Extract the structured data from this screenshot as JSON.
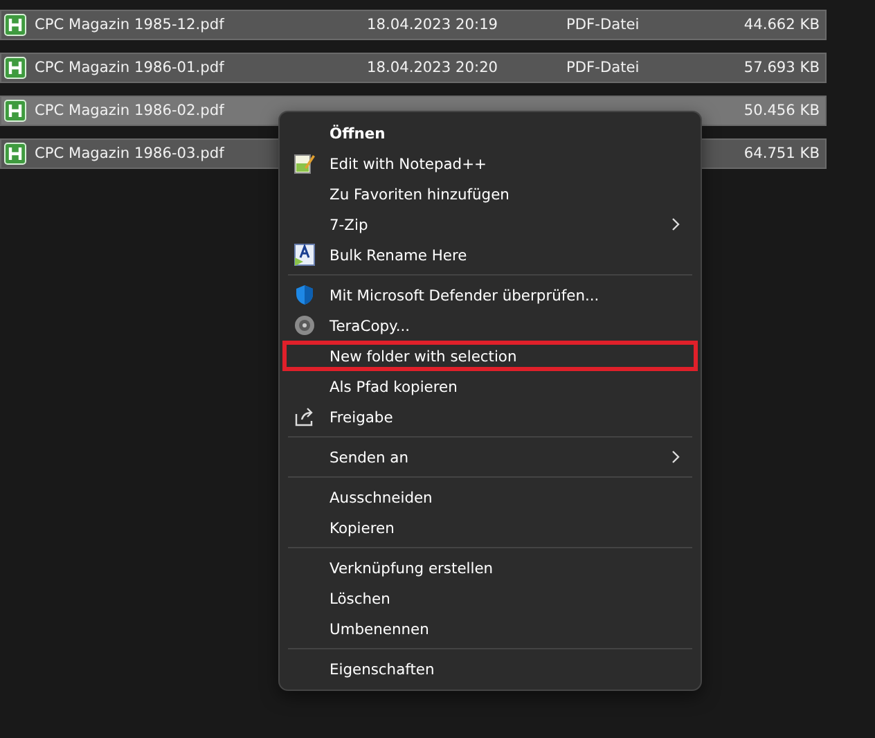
{
  "files": [
    {
      "name": "CPC Magazin 1985-12.pdf",
      "date": "18.04.2023 20:19",
      "type": "PDF-Datei",
      "size": "44.662 KB",
      "selected": true,
      "hovered": false
    },
    {
      "name": "CPC Magazin 1986-01.pdf",
      "date": "18.04.2023 20:20",
      "type": "PDF-Datei",
      "size": "57.693 KB",
      "selected": true,
      "hovered": false
    },
    {
      "name": "CPC Magazin 1986-02.pdf",
      "size": "50.456 KB",
      "selected": true,
      "hovered": true
    },
    {
      "name": "CPC Magazin 1986-03.pdf",
      "size": "64.751 KB",
      "selected": true,
      "hovered": false
    }
  ],
  "context_menu": {
    "groups": [
      [
        {
          "label": "Öffnen",
          "kind": "plain",
          "default": true,
          "submenu": false,
          "outlined": false
        },
        {
          "label": "Edit with Notepad++",
          "kind": "notepad",
          "default": false,
          "submenu": false,
          "outlined": false
        },
        {
          "label": "Zu Favoriten hinzufügen",
          "kind": "plain",
          "default": false,
          "submenu": false,
          "outlined": false
        },
        {
          "label": "7-Zip",
          "kind": "plain",
          "default": false,
          "submenu": true,
          "outlined": false
        },
        {
          "label": "Bulk Rename Here",
          "kind": "rename",
          "default": false,
          "submenu": false,
          "outlined": false
        }
      ],
      [
        {
          "label": "Mit Microsoft Defender überprüfen...",
          "kind": "shield",
          "default": false,
          "submenu": false,
          "outlined": false
        },
        {
          "label": "TeraCopy...",
          "kind": "disc",
          "default": false,
          "submenu": false,
          "outlined": false
        },
        {
          "label": "New folder with selection",
          "kind": "plain",
          "default": false,
          "submenu": false,
          "outlined": true
        },
        {
          "label": "Als Pfad kopieren",
          "kind": "plain",
          "default": false,
          "submenu": false,
          "outlined": false
        },
        {
          "label": "Freigabe",
          "kind": "share",
          "default": false,
          "submenu": false,
          "outlined": false
        }
      ],
      [
        {
          "label": "Senden an",
          "kind": "plain",
          "default": false,
          "submenu": true,
          "outlined": false
        }
      ],
      [
        {
          "label": "Ausschneiden",
          "kind": "plain",
          "default": false,
          "submenu": false,
          "outlined": false
        },
        {
          "label": "Kopieren",
          "kind": "plain",
          "default": false,
          "submenu": false,
          "outlined": false
        }
      ],
      [
        {
          "label": "Verknüpfung erstellen",
          "kind": "plain",
          "default": false,
          "submenu": false,
          "outlined": false
        },
        {
          "label": "Löschen",
          "kind": "plain",
          "default": false,
          "submenu": false,
          "outlined": false
        },
        {
          "label": "Umbenennen",
          "kind": "plain",
          "default": false,
          "submenu": false,
          "outlined": false
        }
      ],
      [
        {
          "label": "Eigenschaften",
          "kind": "plain",
          "default": false,
          "submenu": false,
          "outlined": false
        }
      ]
    ]
  }
}
